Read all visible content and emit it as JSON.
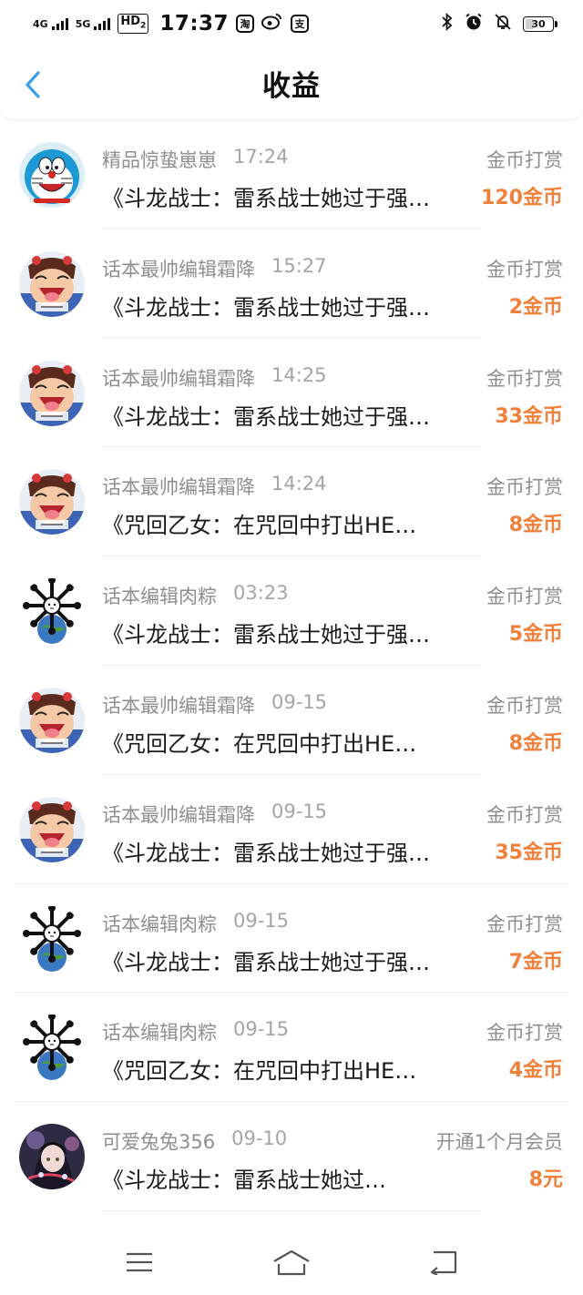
{
  "status_bar": {
    "signal1": "4G",
    "signal2": "5G",
    "hd": "HD",
    "hd_sub": "2",
    "time": "17:37",
    "taobao_glyph": "淘",
    "alipay_glyph": "支",
    "battery": "30",
    "icons": [
      "signal-icon",
      "taobao-icon",
      "weibo-icon",
      "alipay-icon",
      "bluetooth-icon",
      "alarm-icon",
      "mute-icon",
      "battery-icon"
    ]
  },
  "header": {
    "title": "收益",
    "back_icon": "chevron-left-icon",
    "accent": "#3a9fe8"
  },
  "rows": [
    {
      "user": "精品惊蛰崽崽",
      "time": "17:24",
      "type": "金币打赏",
      "work": "《斗龙战士：雷系战士她过于强…",
      "amount": "120金币",
      "avatar": "doraemon"
    },
    {
      "user": "话本最帅编辑霜降",
      "time": "15:27",
      "type": "金币打赏",
      "work": "《斗龙战士：雷系战士她过于强…",
      "amount": "2金币",
      "avatar": "cartoon"
    },
    {
      "user": "话本最帅编辑霜降",
      "time": "14:25",
      "type": "金币打赏",
      "work": "《斗龙战士：雷系战士她过于强…",
      "amount": "33金币",
      "avatar": "cartoon"
    },
    {
      "user": "话本最帅编辑霜降",
      "time": "14:24",
      "type": "金币打赏",
      "work": "《咒回乙女：在咒回中打出HE…",
      "amount": "8金币",
      "avatar": "cartoon"
    },
    {
      "user": "话本编辑肉粽",
      "time": "03:23",
      "type": "金币打赏",
      "work": "《斗龙战士：雷系战士她过于强…",
      "amount": "5金币",
      "avatar": "bones"
    },
    {
      "user": "话本最帅编辑霜降",
      "time": "09-15",
      "type": "金币打赏",
      "work": "《咒回乙女：在咒回中打出HE…",
      "amount": "8金币",
      "avatar": "cartoon"
    },
    {
      "user": "话本最帅编辑霜降",
      "time": "09-15",
      "type": "金币打赏",
      "work": "《斗龙战士：雷系战士她过于强…",
      "amount": "35金币",
      "avatar": "cartoon"
    },
    {
      "user": "话本编辑肉粽",
      "time": "09-15",
      "type": "金币打赏",
      "work": "《斗龙战士：雷系战士她过于强…",
      "amount": "7金币",
      "avatar": "bones"
    },
    {
      "user": "话本编辑肉粽",
      "time": "09-15",
      "type": "金币打赏",
      "work": "《咒回乙女：在咒回中打出HE…",
      "amount": "4金币",
      "avatar": "bones"
    },
    {
      "user": "可爱兔兔356",
      "time": "09-10",
      "type": "开通1个月会员",
      "work": "《斗龙战士：雷系战士她过…",
      "amount": "8元",
      "avatar": "anime"
    }
  ],
  "colors": {
    "amount": "#f0813c",
    "meta": "#8f8f8f"
  },
  "bottom_nav": {
    "icons": [
      "menu-icon",
      "home-icon",
      "back-icon"
    ]
  }
}
